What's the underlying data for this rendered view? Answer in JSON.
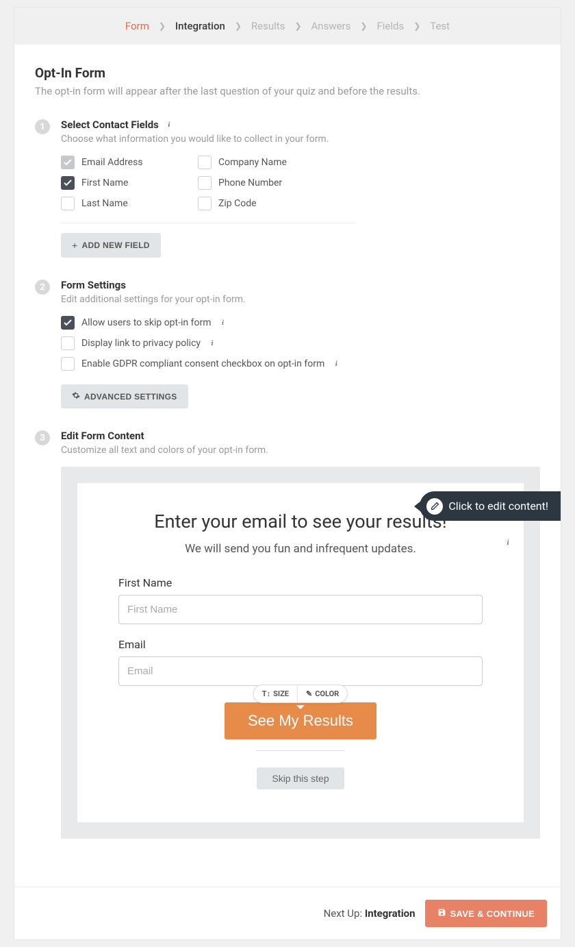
{
  "tabs": [
    "Form",
    "Integration",
    "Results",
    "Answers",
    "Fields",
    "Test"
  ],
  "page": {
    "title": "Opt-In Form",
    "subtitle": "The opt-in form will appear after the last question of your quiz and before the results."
  },
  "step1": {
    "num": "1",
    "title": "Select Contact Fields",
    "subtitle": "Choose what information you would like to collect in your form.",
    "fields": [
      {
        "label": "Email Address",
        "checked": true,
        "locked": true
      },
      {
        "label": "Company Name",
        "checked": false,
        "locked": false
      },
      {
        "label": "First Name",
        "checked": true,
        "locked": false
      },
      {
        "label": "Phone Number",
        "checked": false,
        "locked": false
      },
      {
        "label": "Last Name",
        "checked": false,
        "locked": false
      },
      {
        "label": "Zip Code",
        "checked": false,
        "locked": false
      }
    ],
    "addButton": "ADD NEW FIELD"
  },
  "step2": {
    "num": "2",
    "title": "Form Settings",
    "subtitle": "Edit additional settings for your opt-in form.",
    "settings": [
      {
        "label": "Allow users to skip opt-in form",
        "checked": true
      },
      {
        "label": "Display link to privacy policy",
        "checked": false
      },
      {
        "label": "Enable GDPR compliant consent checkbox on opt-in form",
        "checked": false
      }
    ],
    "advButton": "ADVANCED SETTINGS"
  },
  "step3": {
    "num": "3",
    "title": "Edit Form Content",
    "subtitle": "Customize all text and colors of your opt-in form."
  },
  "preview": {
    "title": "Enter your email to see your results!",
    "subtitle": "We will send you fun and infrequent updates.",
    "fields": [
      {
        "label": "First Name",
        "placeholder": "First Name"
      },
      {
        "label": "Email",
        "placeholder": "Email"
      }
    ],
    "toolbar": {
      "size": "SIZE",
      "color": "COLOR"
    },
    "submit": "See My Results",
    "skip": "Skip this step",
    "callout": "Click to edit content!"
  },
  "footer": {
    "nextUpLabel": "Next Up: ",
    "nextUpValue": "Integration",
    "save": "SAVE & CONTINUE"
  }
}
